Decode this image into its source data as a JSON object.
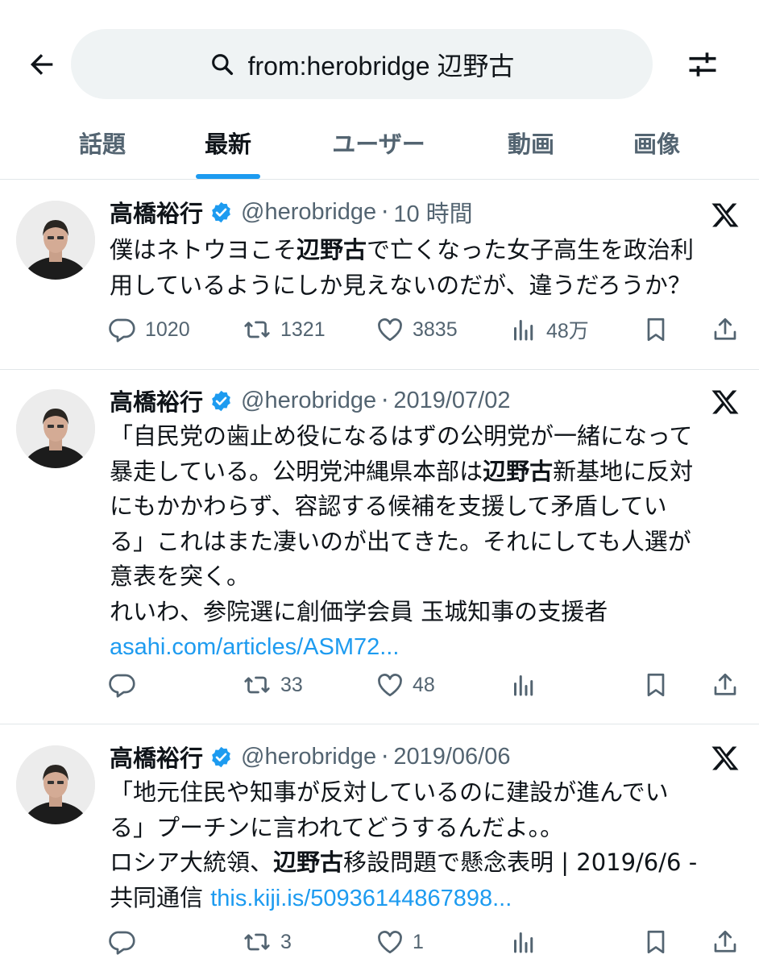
{
  "search": {
    "query": "from:herobridge 辺野古"
  },
  "tabs": [
    {
      "label": "話題"
    },
    {
      "label": "最新"
    },
    {
      "label": "ユーザー"
    },
    {
      "label": "動画"
    },
    {
      "label": "画像"
    }
  ],
  "colors": {
    "accent": "#1d9bf0",
    "muted": "#536471",
    "text": "#0f1419",
    "divider": "#e1e6e9"
  },
  "icons": [
    "back-arrow-icon",
    "search-icon",
    "filter-icon",
    "verified-badge-icon",
    "x-logo-icon",
    "reply-icon",
    "repost-icon",
    "like-icon",
    "views-icon",
    "bookmark-icon",
    "share-icon"
  ],
  "tweets": [
    {
      "name": "高橋裕行",
      "handle": "@herobridge",
      "sep": "·",
      "time": "10 時間",
      "lines": [
        {
          "pre": "僕はネトウヨこそ",
          "hl": "辺野古",
          "post": "で亡くなった女子高生を政治利"
        },
        {
          "pre": "用しているようにしか見えないのだが、違うだろうか？"
        }
      ],
      "stats": {
        "replies": "1020",
        "reposts": "1321",
        "likes": "3835",
        "views": "48万"
      }
    },
    {
      "name": "高橋裕行",
      "handle": "@herobridge",
      "sep": "·",
      "time": "2019/07/02",
      "lines": [
        {
          "pre": "「自民党の歯止め役になるはずの公明党が一緒になって"
        },
        {
          "pre": "暴走している。公明党沖縄県本部は",
          "hl": "辺野古",
          "post": "新基地に反対"
        },
        {
          "pre": "にもかかわらず、容認する候補を支援して矛盾してい"
        },
        {
          "pre": "る」これはまた凄いのが出てきた。それにしても人選が"
        },
        {
          "pre": "意表を突く。"
        },
        {
          "pre": "れいわ、参院選に創価学会員  玉城知事の支援者"
        }
      ],
      "link": "asahi.com/articles/ASM72...",
      "stats": {
        "replies": "",
        "reposts": "33",
        "likes": "48",
        "views": ""
      }
    },
    {
      "name": "高橋裕行",
      "handle": "@herobridge",
      "sep": "·",
      "time": "2019/06/06",
      "lines": [
        {
          "pre": "「地元住民や知事が反対しているのに建設が進んでい"
        },
        {
          "pre": "る」プーチンに言われてどうするんだよ。。"
        },
        {
          "pre": "ロシア大統領、",
          "hl": "辺野古",
          "post": "移設問題で懸念表明 | 2019/6/6 -"
        },
        {
          "pre": "共同通信 "
        }
      ],
      "link": "this.kiji.is/50936144867898...",
      "stats": {
        "replies": "",
        "reposts": "3",
        "likes": "1",
        "views": ""
      }
    }
  ]
}
